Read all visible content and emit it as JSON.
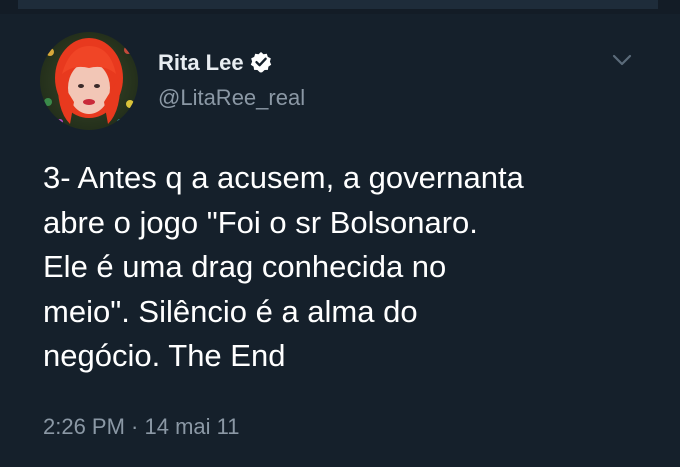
{
  "user": {
    "display_name": "Rita Lee",
    "handle": "@LitaRee_real",
    "verified": true
  },
  "tweet": {
    "text": "3- Antes q a acusem, a governanta\nabre o jogo \"Foi o sr Bolsonaro.\nEle é uma drag conhecida no\nmeio\".  Silêncio é a alma do\nnegócio. The End",
    "timestamp": "2:26 PM · 14 mai 11"
  },
  "icons": {
    "verified": "verified-badge-icon",
    "menu": "chevron-down-icon"
  },
  "colors": {
    "background": "#15202b",
    "text_primary": "#ffffff",
    "text_secondary": "#8b98a5"
  }
}
